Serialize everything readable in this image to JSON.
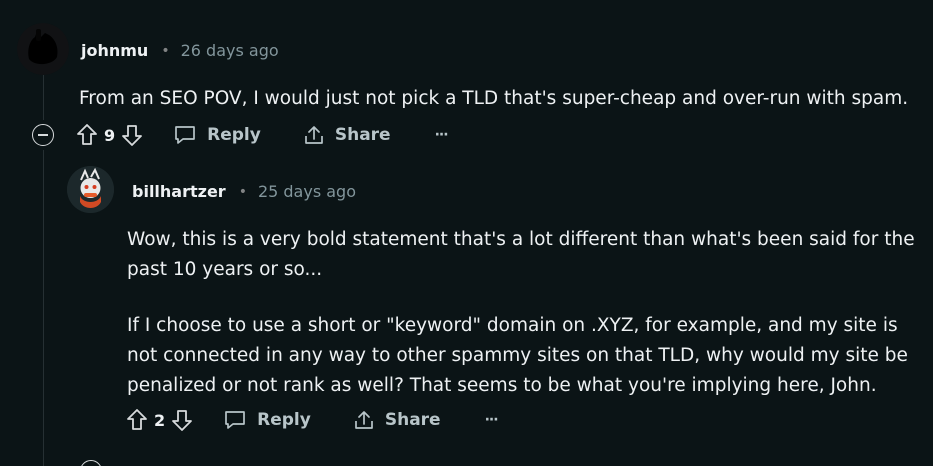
{
  "comments": [
    {
      "username": "johnmu",
      "separator": "•",
      "timestamp": "26 days ago",
      "body": [
        "From an SEO POV, I would just not pick a TLD that's super-cheap and over-run with spam."
      ],
      "score": "9",
      "reply_label": "Reply",
      "share_label": "Share",
      "more_label": "···"
    },
    {
      "username": "billhartzer",
      "separator": "•",
      "timestamp": "25 days ago",
      "body": [
        "Wow, this is a very bold statement that's a lot different than what's been said for the",
        "past 10 years or so...",
        "If I choose to use a short or \"keyword\" domain on .XYZ, for example, and my site is",
        "not connected in any way to other spammy sites on that TLD, why would my site be",
        "penalized or not rank as well? That seems to be what you're implying here, John."
      ],
      "score": "2",
      "reply_label": "Reply",
      "share_label": "Share",
      "more_label": "···"
    }
  ]
}
